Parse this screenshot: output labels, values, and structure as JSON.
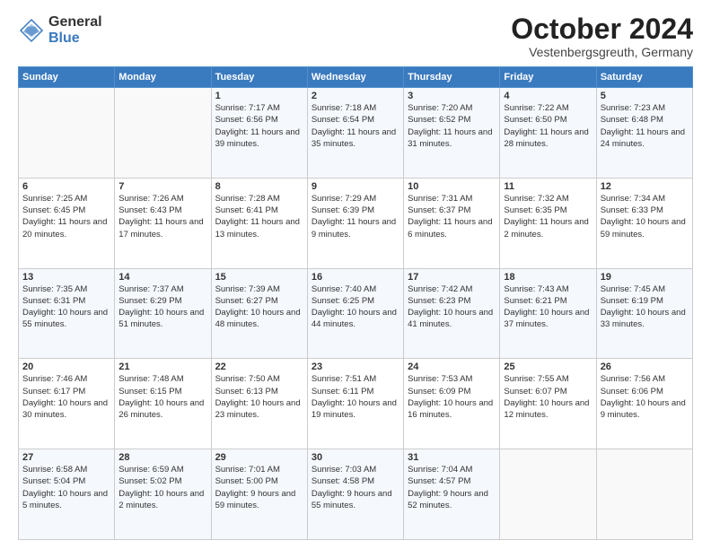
{
  "logo": {
    "general": "General",
    "blue": "Blue"
  },
  "title": "October 2024",
  "location": "Vestenbergsgreuth, Germany",
  "days_of_week": [
    "Sunday",
    "Monday",
    "Tuesday",
    "Wednesday",
    "Thursday",
    "Friday",
    "Saturday"
  ],
  "weeks": [
    [
      {
        "day": "",
        "info": ""
      },
      {
        "day": "",
        "info": ""
      },
      {
        "day": "1",
        "info": "Sunrise: 7:17 AM\nSunset: 6:56 PM\nDaylight: 11 hours and 39 minutes."
      },
      {
        "day": "2",
        "info": "Sunrise: 7:18 AM\nSunset: 6:54 PM\nDaylight: 11 hours and 35 minutes."
      },
      {
        "day": "3",
        "info": "Sunrise: 7:20 AM\nSunset: 6:52 PM\nDaylight: 11 hours and 31 minutes."
      },
      {
        "day": "4",
        "info": "Sunrise: 7:22 AM\nSunset: 6:50 PM\nDaylight: 11 hours and 28 minutes."
      },
      {
        "day": "5",
        "info": "Sunrise: 7:23 AM\nSunset: 6:48 PM\nDaylight: 11 hours and 24 minutes."
      }
    ],
    [
      {
        "day": "6",
        "info": "Sunrise: 7:25 AM\nSunset: 6:45 PM\nDaylight: 11 hours and 20 minutes."
      },
      {
        "day": "7",
        "info": "Sunrise: 7:26 AM\nSunset: 6:43 PM\nDaylight: 11 hours and 17 minutes."
      },
      {
        "day": "8",
        "info": "Sunrise: 7:28 AM\nSunset: 6:41 PM\nDaylight: 11 hours and 13 minutes."
      },
      {
        "day": "9",
        "info": "Sunrise: 7:29 AM\nSunset: 6:39 PM\nDaylight: 11 hours and 9 minutes."
      },
      {
        "day": "10",
        "info": "Sunrise: 7:31 AM\nSunset: 6:37 PM\nDaylight: 11 hours and 6 minutes."
      },
      {
        "day": "11",
        "info": "Sunrise: 7:32 AM\nSunset: 6:35 PM\nDaylight: 11 hours and 2 minutes."
      },
      {
        "day": "12",
        "info": "Sunrise: 7:34 AM\nSunset: 6:33 PM\nDaylight: 10 hours and 59 minutes."
      }
    ],
    [
      {
        "day": "13",
        "info": "Sunrise: 7:35 AM\nSunset: 6:31 PM\nDaylight: 10 hours and 55 minutes."
      },
      {
        "day": "14",
        "info": "Sunrise: 7:37 AM\nSunset: 6:29 PM\nDaylight: 10 hours and 51 minutes."
      },
      {
        "day": "15",
        "info": "Sunrise: 7:39 AM\nSunset: 6:27 PM\nDaylight: 10 hours and 48 minutes."
      },
      {
        "day": "16",
        "info": "Sunrise: 7:40 AM\nSunset: 6:25 PM\nDaylight: 10 hours and 44 minutes."
      },
      {
        "day": "17",
        "info": "Sunrise: 7:42 AM\nSunset: 6:23 PM\nDaylight: 10 hours and 41 minutes."
      },
      {
        "day": "18",
        "info": "Sunrise: 7:43 AM\nSunset: 6:21 PM\nDaylight: 10 hours and 37 minutes."
      },
      {
        "day": "19",
        "info": "Sunrise: 7:45 AM\nSunset: 6:19 PM\nDaylight: 10 hours and 33 minutes."
      }
    ],
    [
      {
        "day": "20",
        "info": "Sunrise: 7:46 AM\nSunset: 6:17 PM\nDaylight: 10 hours and 30 minutes."
      },
      {
        "day": "21",
        "info": "Sunrise: 7:48 AM\nSunset: 6:15 PM\nDaylight: 10 hours and 26 minutes."
      },
      {
        "day": "22",
        "info": "Sunrise: 7:50 AM\nSunset: 6:13 PM\nDaylight: 10 hours and 23 minutes."
      },
      {
        "day": "23",
        "info": "Sunrise: 7:51 AM\nSunset: 6:11 PM\nDaylight: 10 hours and 19 minutes."
      },
      {
        "day": "24",
        "info": "Sunrise: 7:53 AM\nSunset: 6:09 PM\nDaylight: 10 hours and 16 minutes."
      },
      {
        "day": "25",
        "info": "Sunrise: 7:55 AM\nSunset: 6:07 PM\nDaylight: 10 hours and 12 minutes."
      },
      {
        "day": "26",
        "info": "Sunrise: 7:56 AM\nSunset: 6:06 PM\nDaylight: 10 hours and 9 minutes."
      }
    ],
    [
      {
        "day": "27",
        "info": "Sunrise: 6:58 AM\nSunset: 5:04 PM\nDaylight: 10 hours and 5 minutes."
      },
      {
        "day": "28",
        "info": "Sunrise: 6:59 AM\nSunset: 5:02 PM\nDaylight: 10 hours and 2 minutes."
      },
      {
        "day": "29",
        "info": "Sunrise: 7:01 AM\nSunset: 5:00 PM\nDaylight: 9 hours and 59 minutes."
      },
      {
        "day": "30",
        "info": "Sunrise: 7:03 AM\nSunset: 4:58 PM\nDaylight: 9 hours and 55 minutes."
      },
      {
        "day": "31",
        "info": "Sunrise: 7:04 AM\nSunset: 4:57 PM\nDaylight: 9 hours and 52 minutes."
      },
      {
        "day": "",
        "info": ""
      },
      {
        "day": "",
        "info": ""
      }
    ]
  ]
}
